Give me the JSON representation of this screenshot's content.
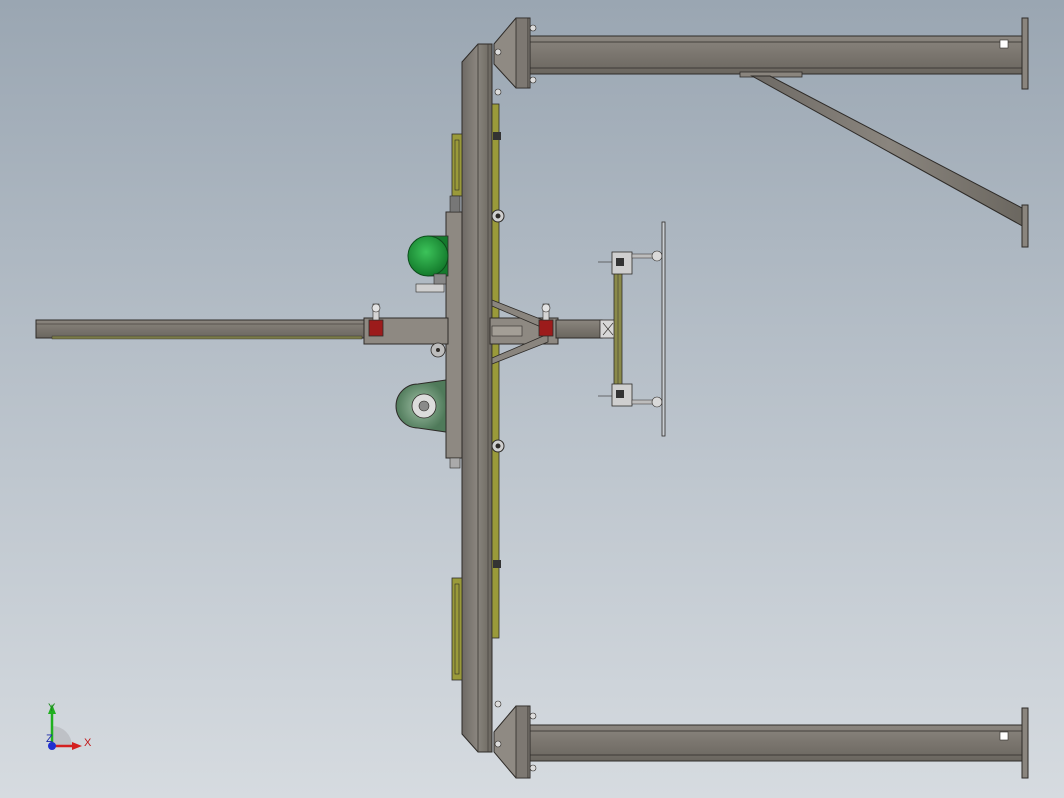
{
  "viewport": {
    "background_top": "#9aa6b2",
    "background_bottom": "#d6dbe0"
  },
  "colors": {
    "steel": "#7d7872",
    "steel_dark": "#2e2b28",
    "rail_yellow": "#9a9a3a",
    "motor_green": "#1e9a3c",
    "gear_green": "#5f8f6a",
    "stop_red": "#9c1b1b",
    "glass_edge": "#c9ced3"
  },
  "triad": {
    "y_label": "Y",
    "x_label": "X",
    "z_label": "Z",
    "x_color": "#d42020",
    "y_color": "#20b020",
    "z_color": "#2030d0"
  }
}
